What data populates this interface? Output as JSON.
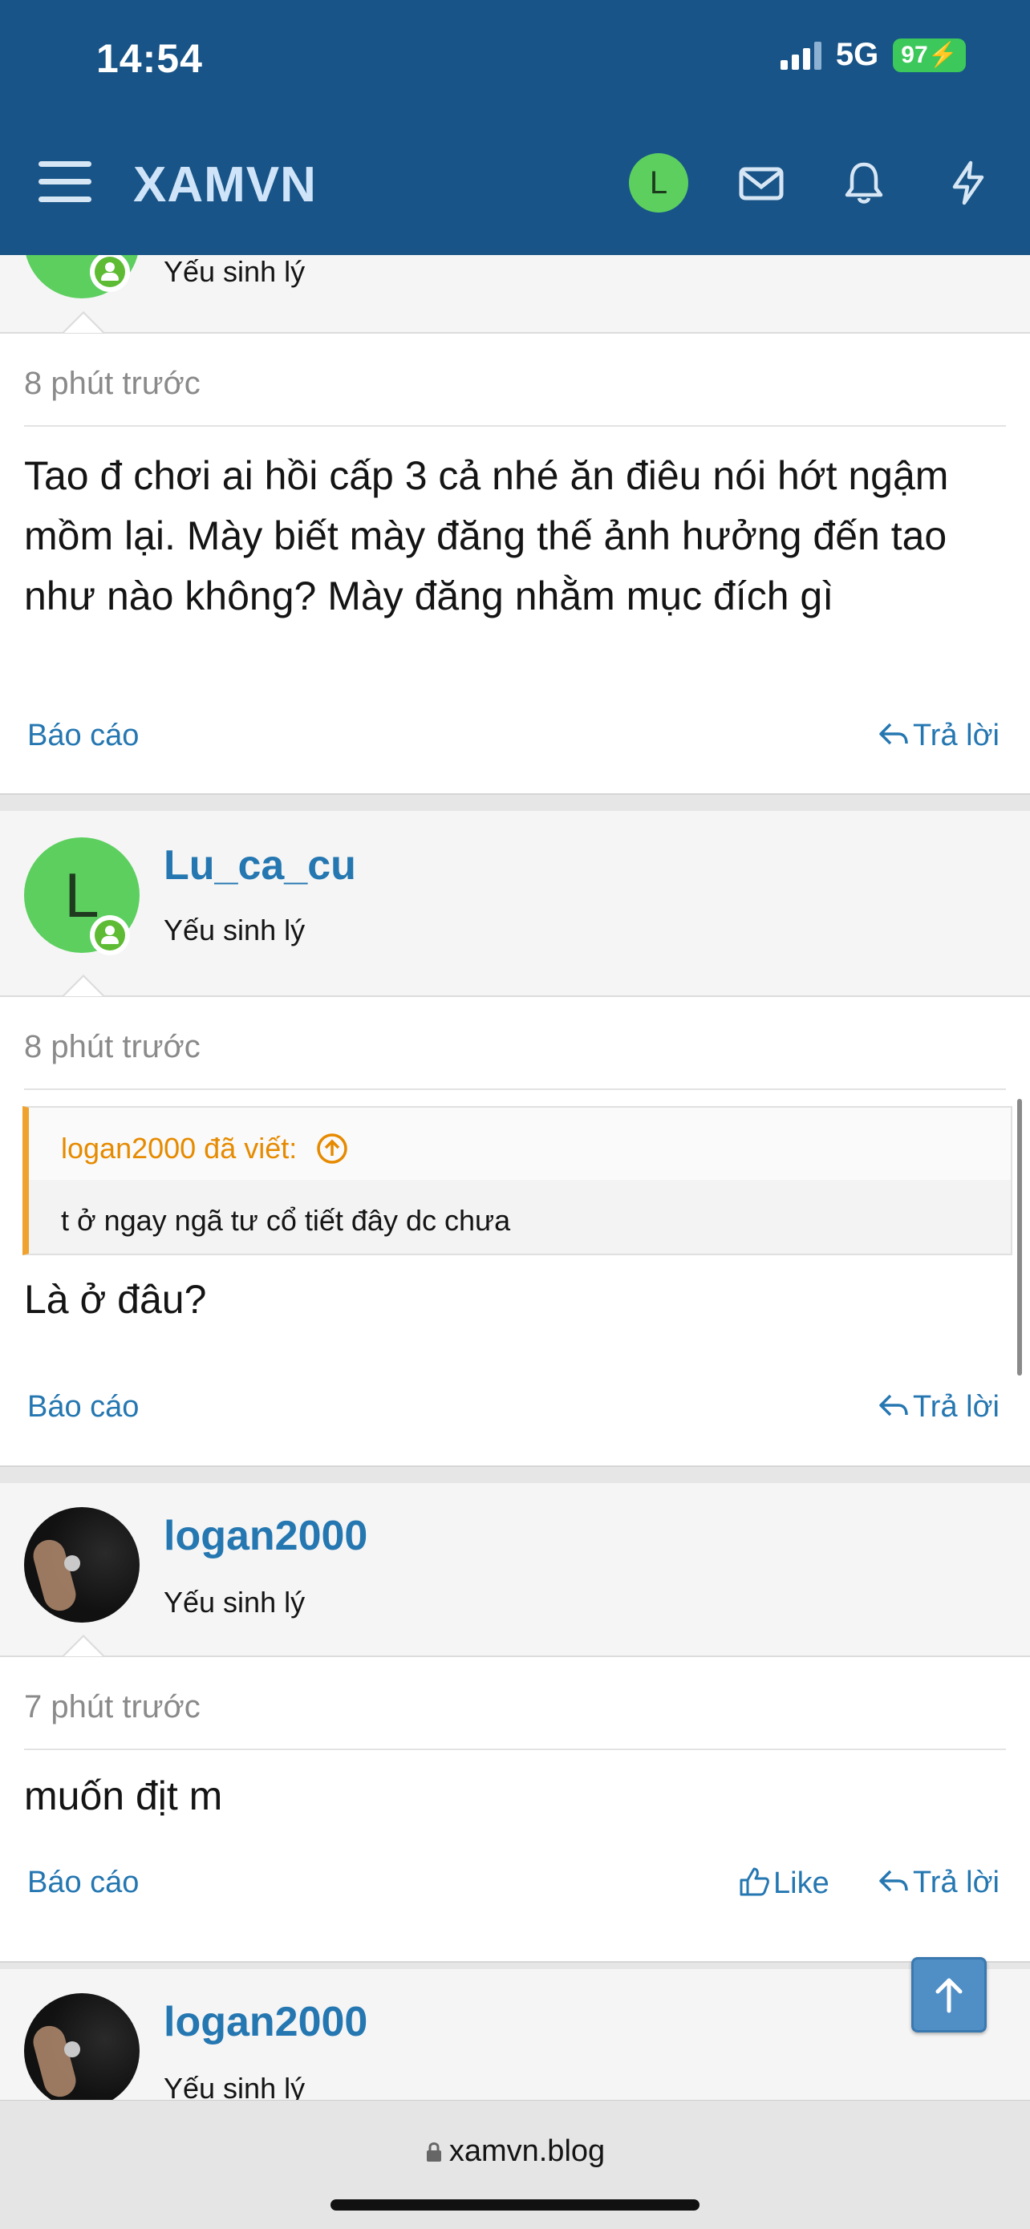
{
  "status_bar": {
    "time": "14:54",
    "network": "5G",
    "battery": "97"
  },
  "header": {
    "brand": "XAMVN",
    "user_initial": "L"
  },
  "posts": [
    {
      "user_title": "Yếu sinh lý",
      "time": "8 phút trước",
      "message": "Tao đ chơi ai hồi cấp 3 cả nhé ăn điêu nói hớt ngậm mồm lại. Mày biết mày đăng thế ảnh hưởng đến tao như nào không? Mày đăng nhằm mục đích gì",
      "report_label": "Báo cáo",
      "reply_label": "Trả lời"
    },
    {
      "username": "Lu_ca_cu",
      "avatar_initial": "L",
      "user_title": "Yếu sinh lý",
      "time": "8 phút trước",
      "quote_author": "logan2000 đã viết:",
      "quote_text": "t ở ngay ngã tư cổ tiết đây dc chưa",
      "message": "Là ở đâu?",
      "report_label": "Báo cáo",
      "reply_label": "Trả lời"
    },
    {
      "username": "logan2000",
      "user_title": "Yếu sinh lý",
      "time": "7 phút trước",
      "message": "muốn địt m",
      "report_label": "Báo cáo",
      "like_label": "Like",
      "reply_label": "Trả lời"
    },
    {
      "username": "logan2000",
      "user_title": "Yếu sinh lý"
    }
  ],
  "browser": {
    "url": "xamvn.blog"
  },
  "colors": {
    "header": "#185487",
    "link": "#2577b1",
    "online": "#5dbb34",
    "quote_border": "#f0a22e"
  }
}
